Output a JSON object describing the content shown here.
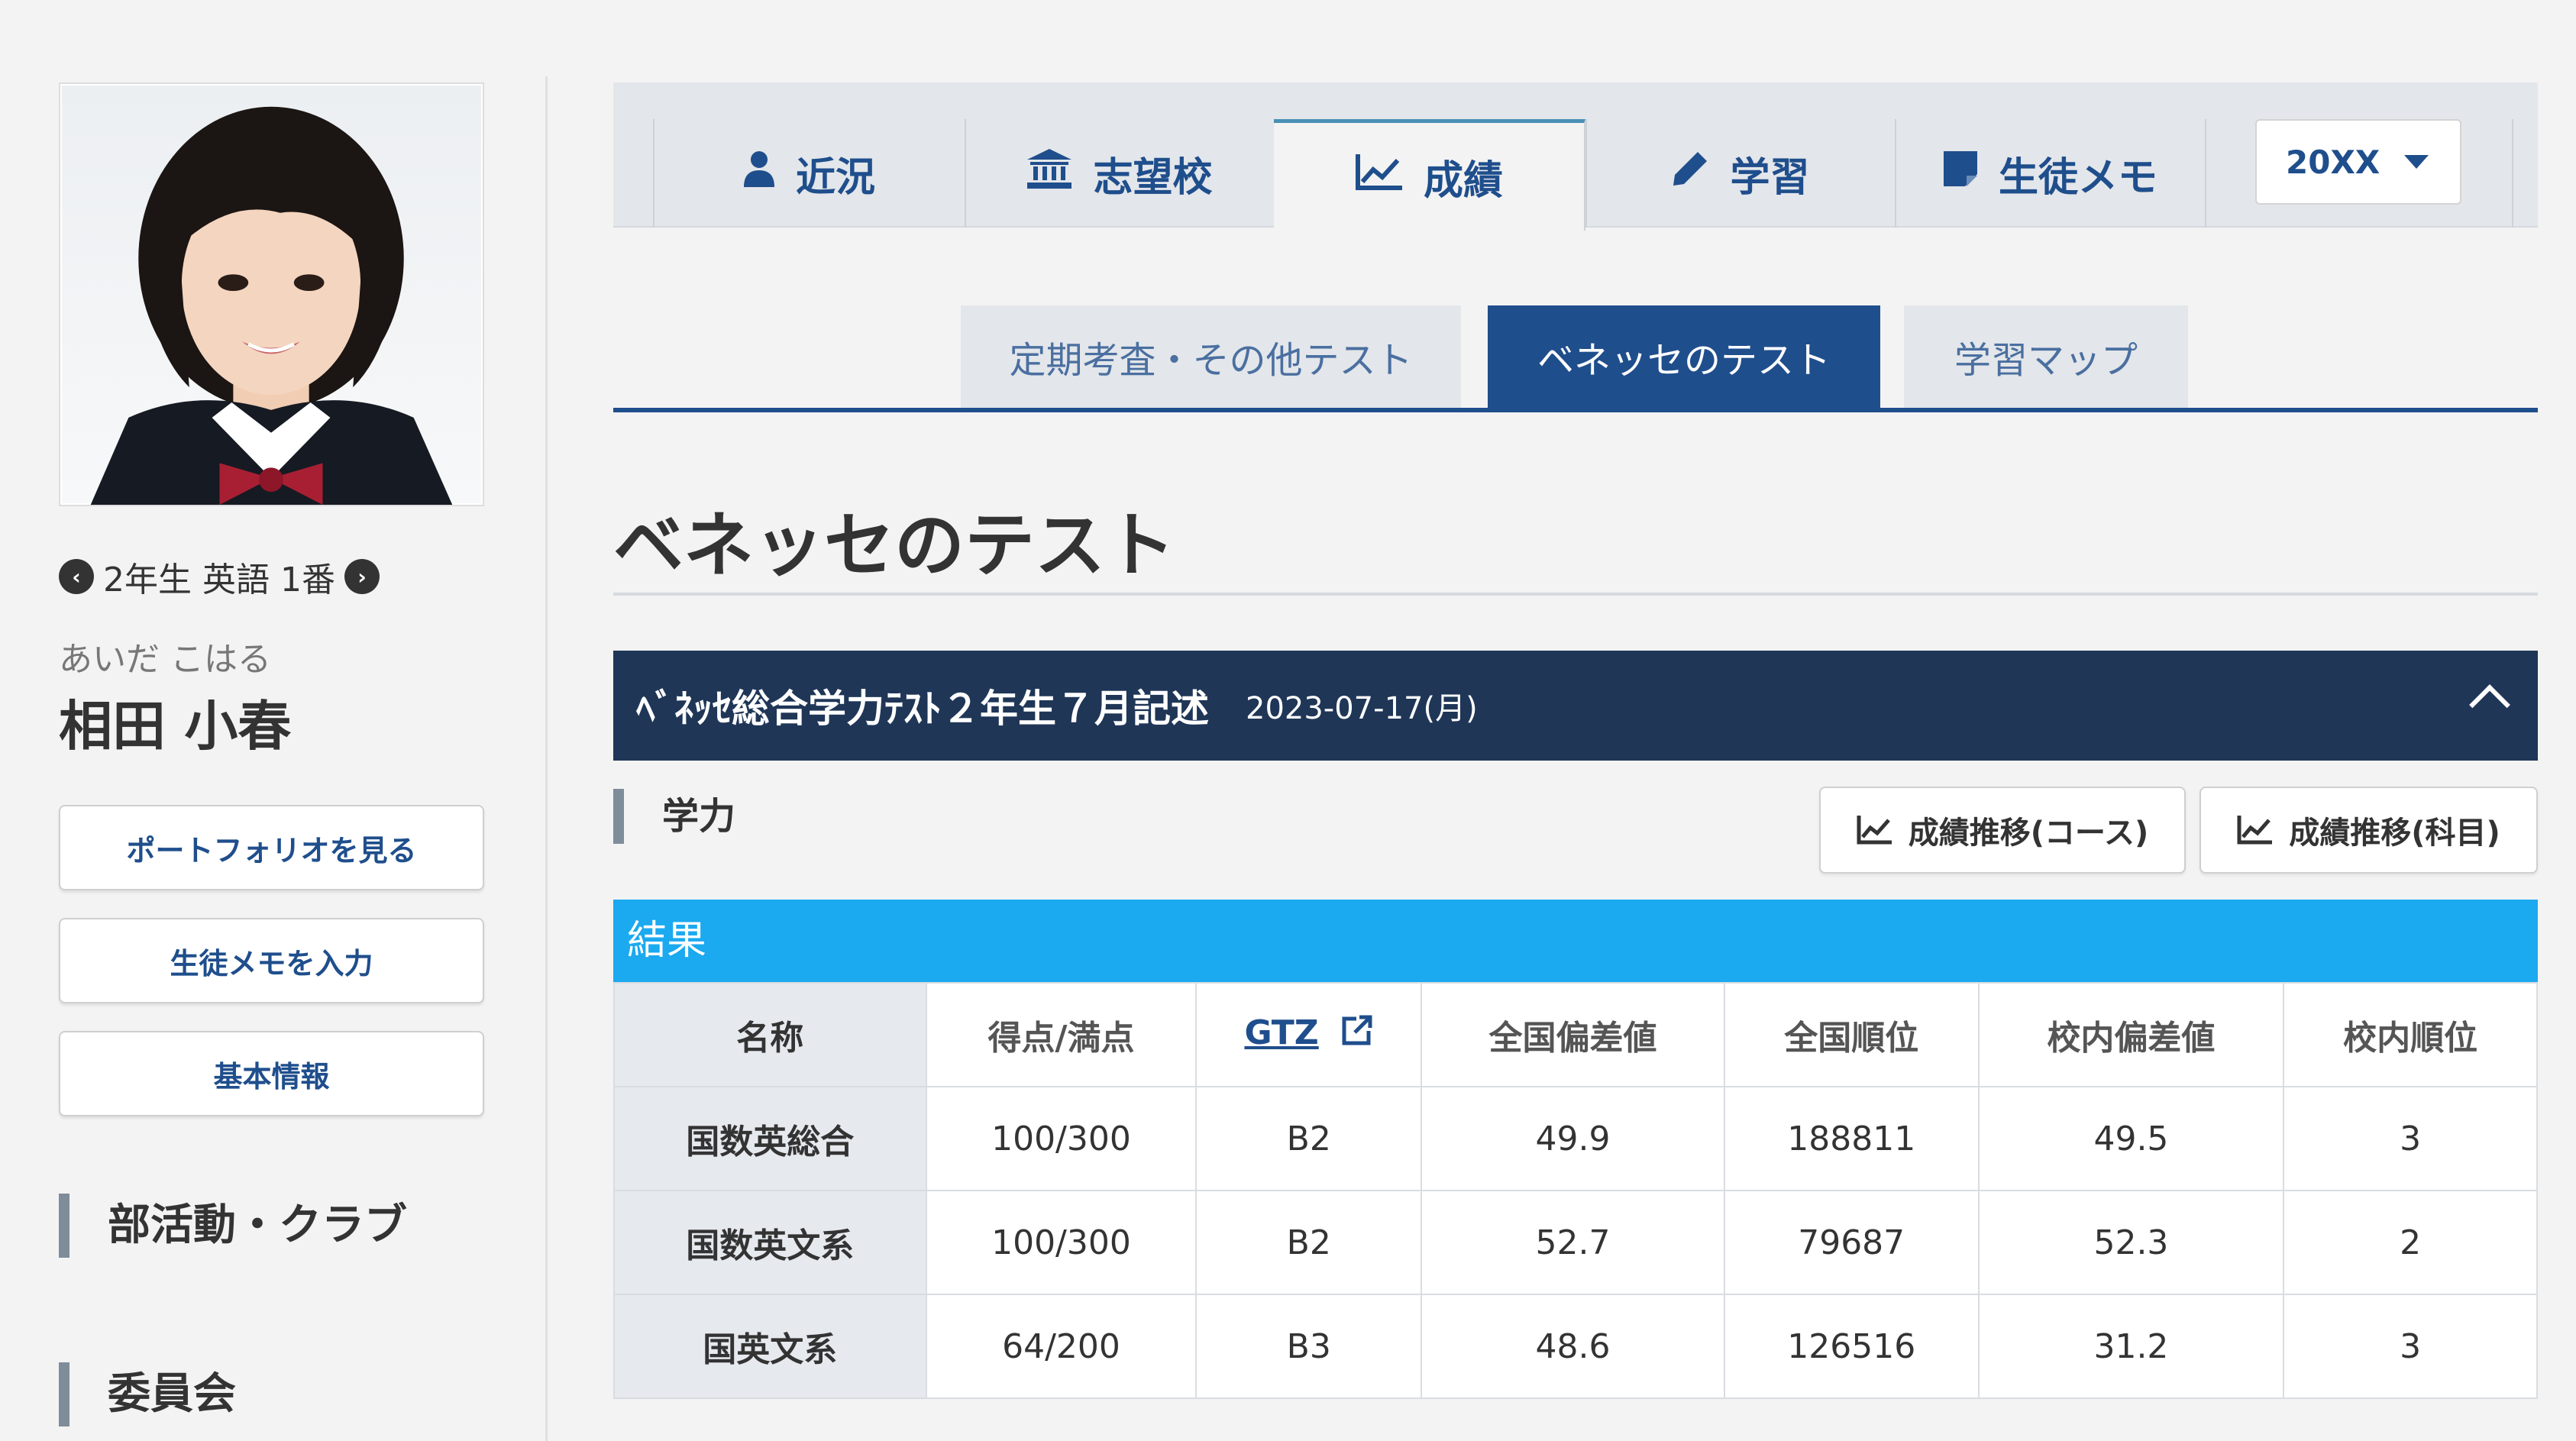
{
  "sidebar": {
    "student_position": "2年生 英語 1番",
    "name_kana": "あいだ こはる",
    "name": "相田 小春",
    "buttons": [
      "ポートフォリオを見る",
      "生徒メモを入力",
      "基本情報"
    ],
    "sections": [
      "部活動・クラブ",
      "委員会"
    ]
  },
  "main_tabs": [
    {
      "label": "近況",
      "icon": "user-icon"
    },
    {
      "label": "志望校",
      "icon": "institution-icon"
    },
    {
      "label": "成績",
      "icon": "line-chart-icon",
      "active": true
    },
    {
      "label": "学習",
      "icon": "pencil-icon"
    },
    {
      "label": "生徒メモ",
      "icon": "note-icon"
    }
  ],
  "year_select": {
    "value": "20XX"
  },
  "sub_tabs": [
    {
      "label": "定期考査・その他テスト"
    },
    {
      "label": "ベネッセのテスト",
      "active": true
    },
    {
      "label": "学習マップ"
    }
  ],
  "page_title": "ベネッセのテスト",
  "exam": {
    "title": "ﾍﾞﾈｯｾ総合学力ﾃｽﾄ２年生７月記述",
    "date": "2023-07-17(月)"
  },
  "section": {
    "label": "学力",
    "trend_course": "成績推移(コース)",
    "trend_subject": "成績推移(科目)"
  },
  "results": {
    "title": "結果",
    "headers": [
      "名称",
      "得点/満点",
      "GTZ",
      "全国偏差値",
      "全国順位",
      "校内偏差値",
      "校内順位"
    ],
    "rows": [
      [
        "国数英総合",
        "100/300",
        "B2",
        "49.9",
        "188811",
        "49.5",
        "3"
      ],
      [
        "国数英文系",
        "100/300",
        "B2",
        "52.7",
        "79687",
        "52.3",
        "2"
      ],
      [
        "国英文系",
        "64/200",
        "B3",
        "48.6",
        "126516",
        "31.2",
        "3"
      ]
    ]
  },
  "colors": {
    "primary": "#1f4e8c",
    "accordion_header": "#1f3657",
    "result_bar": "#1ba9ef"
  }
}
